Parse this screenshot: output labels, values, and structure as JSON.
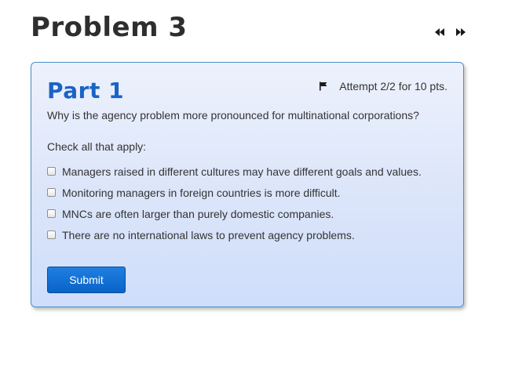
{
  "problem": {
    "title": "Problem 3"
  },
  "nav": {
    "prev_icon": "rewind-icon",
    "next_icon": "fast-forward-icon"
  },
  "part": {
    "title": "Part 1",
    "attempt_icon": "flag-icon",
    "attempt_text": "Attempt 2/2 for 10 pts.",
    "question": "Why is the agency problem more pronounced for multinational corporations?",
    "instruction": "Check all that apply:",
    "options": [
      {
        "label": "Managers raised in different cultures may have different goals and values.",
        "checked": false
      },
      {
        "label": "Monitoring managers in foreign countries is more difficult.",
        "checked": false
      },
      {
        "label": "MNCs are often larger than purely domestic companies.",
        "checked": false
      },
      {
        "label": "There are no international laws to prevent agency problems.",
        "checked": false
      }
    ],
    "submit_label": "Submit"
  },
  "colors": {
    "title_text": "#2e2e2e",
    "part_title": "#1a63c6",
    "card_border": "#4c8fc9",
    "submit_bg": "#0a63c8"
  }
}
